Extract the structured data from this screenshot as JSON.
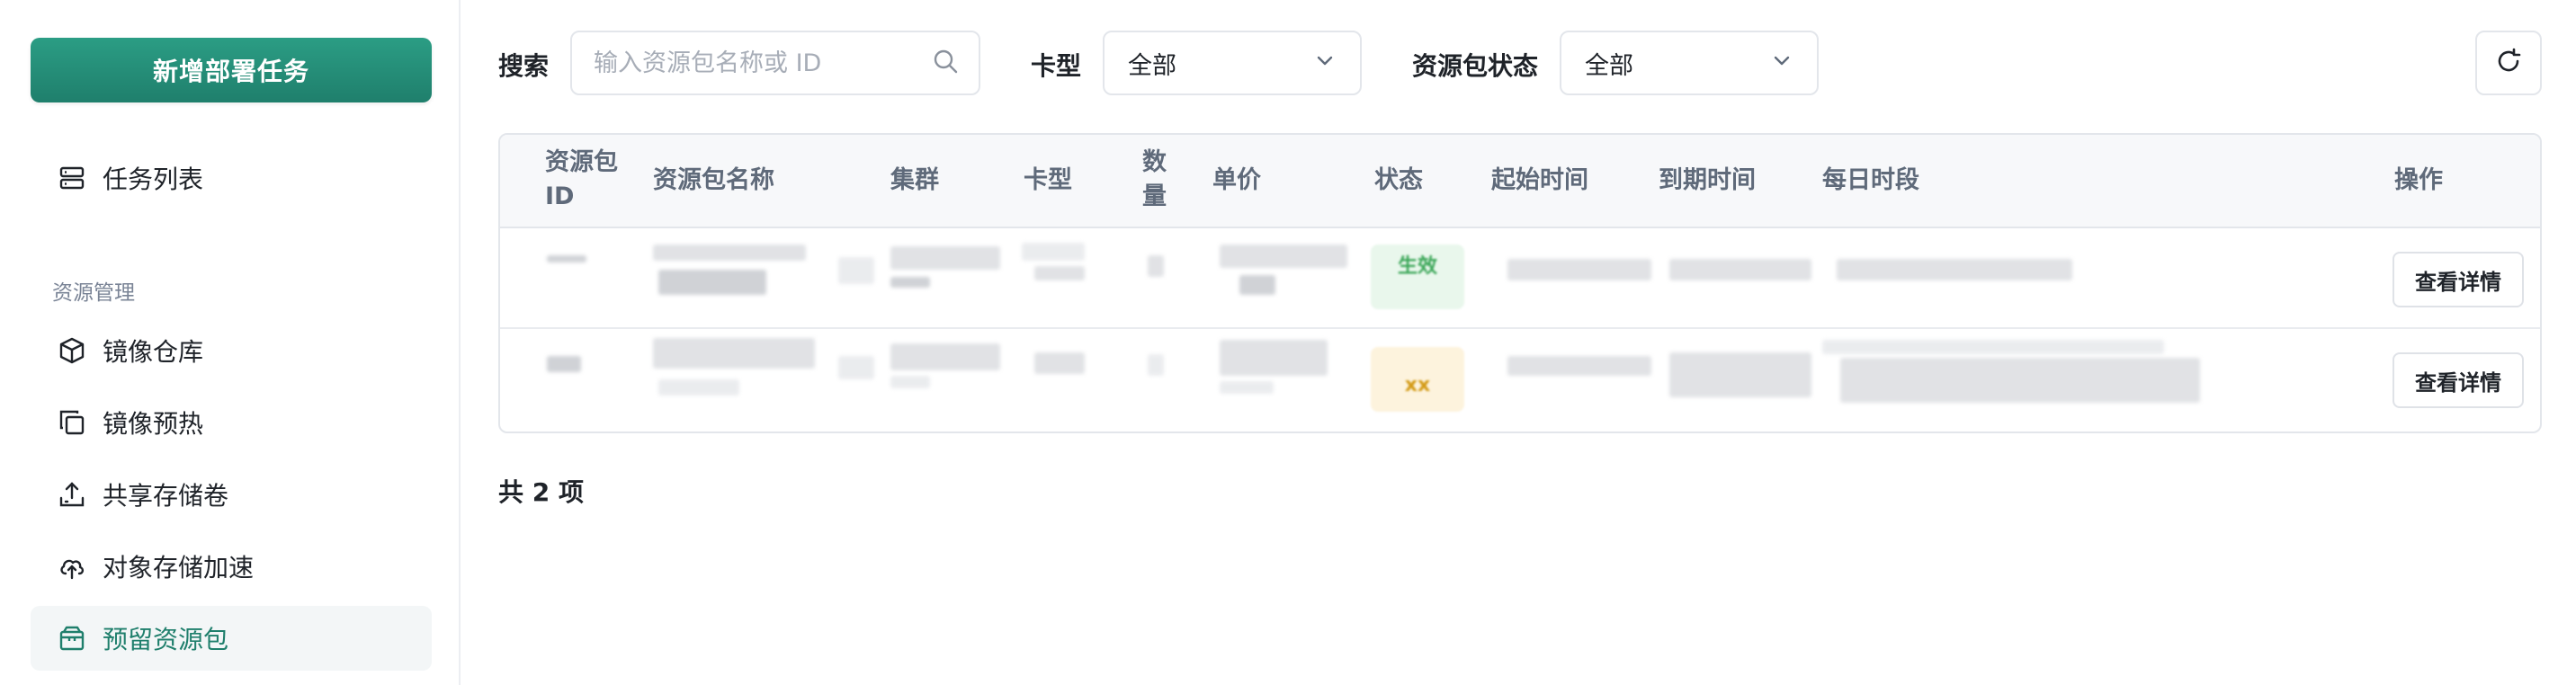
{
  "sidebar": {
    "create_button": "新增部署任务",
    "items": [
      {
        "label": "任务列表",
        "icon": "task-list-icon"
      },
      {
        "label": "镜像仓库",
        "icon": "cube-icon"
      },
      {
        "label": "镜像预热",
        "icon": "copy-icon"
      },
      {
        "label": "共享存储卷",
        "icon": "upload-storage-icon"
      },
      {
        "label": "对象存储加速",
        "icon": "cloud-upload-icon"
      },
      {
        "label": "预留资源包",
        "icon": "package-icon"
      }
    ],
    "section_title": "资源管理",
    "accent_color": "#1f7f6c"
  },
  "filters": {
    "search_label": "搜索",
    "search_placeholder": "输入资源包名称或 ID",
    "card_type_label": "卡型",
    "card_type_value": "全部",
    "status_label": "资源包状态",
    "status_value": "全部"
  },
  "table": {
    "columns": [
      {
        "key": "id",
        "label": "资源包\nID"
      },
      {
        "key": "name",
        "label": "资源包名称"
      },
      {
        "key": "cluster",
        "label": "集群"
      },
      {
        "key": "card_type",
        "label": "卡型"
      },
      {
        "key": "quantity",
        "label": "数\n量"
      },
      {
        "key": "unit_price",
        "label": "单价"
      },
      {
        "key": "status",
        "label": "状态"
      },
      {
        "key": "start_time",
        "label": "起始时间"
      },
      {
        "key": "end_time",
        "label": "到期时间"
      },
      {
        "key": "daily_period",
        "label": "每日时段"
      },
      {
        "key": "actions",
        "label": "操作"
      }
    ],
    "rows": [
      {
        "status": "生效",
        "action_label": "查看详情"
      },
      {
        "status": "xx",
        "action_label": "查看详情"
      }
    ]
  },
  "footer": {
    "total_text": "共 2 项"
  }
}
